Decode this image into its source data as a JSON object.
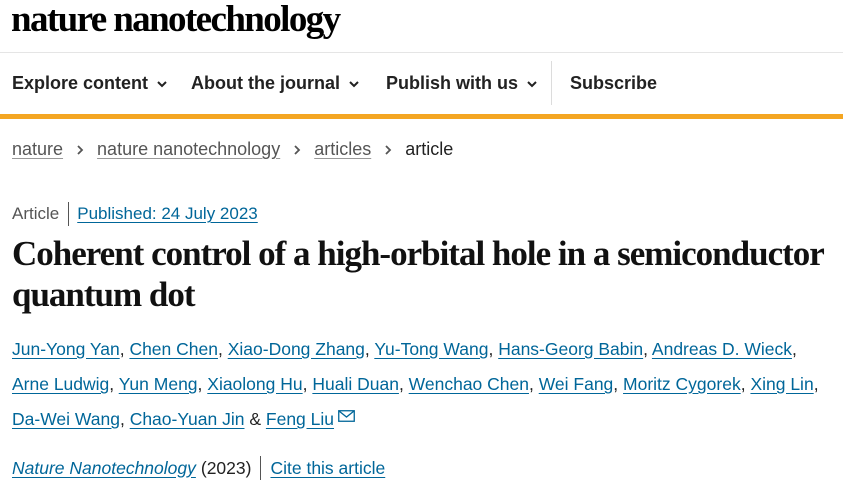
{
  "site": {
    "brand": "nature nanotechnology"
  },
  "nav": [
    {
      "label": "Explore content"
    },
    {
      "label": "About the journal"
    },
    {
      "label": "Publish with us"
    },
    {
      "label": "Subscribe"
    }
  ],
  "breadcrumb": [
    "nature",
    "nature nanotechnology",
    "articles",
    "article"
  ],
  "article": {
    "type": "Article",
    "published": "Published: 24 July 2023",
    "title": "Coherent control of a high-orbital hole in a semiconductor quantum dot",
    "authors": [
      "Jun-Yong Yan",
      "Chen Chen",
      "Xiao-Dong Zhang",
      "Yu-Tong Wang",
      "Hans-Georg Babin",
      "Andreas D. Wieck",
      "Arne Ludwig",
      "Yun Meng",
      "Xiaolong Hu",
      "Huali Duan",
      "Wenchao Chen",
      "Wei Fang",
      "Moritz Cygorek",
      "Xing Lin",
      "Da-Wei Wang",
      "Chao-Yuan Jin",
      "Feng Liu"
    ],
    "journal": "Nature Nanotechnology",
    "year": "(2023)",
    "cite_label": "Cite this article"
  },
  "colors": {
    "accent": "#f4a622",
    "link": "#006699"
  }
}
